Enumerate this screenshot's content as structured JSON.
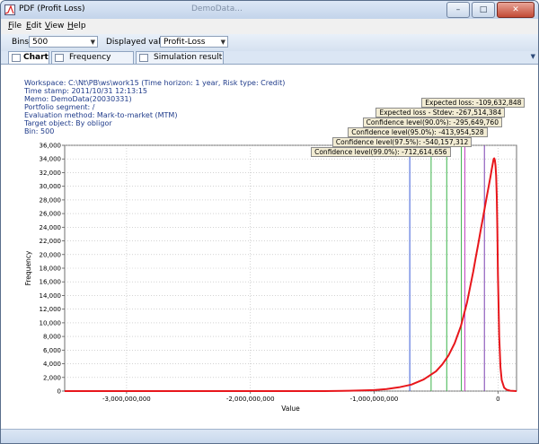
{
  "window": {
    "title": "PDF (Profit Loss)",
    "ghost_title": "DemoData..."
  },
  "titlebar_buttons": {
    "minimize": "–",
    "maximize": "□",
    "close": "✕"
  },
  "menu": {
    "items": [
      {
        "label": "File",
        "mnemonic": "F",
        "rest": "ile"
      },
      {
        "label": "Edit",
        "mnemonic": "E",
        "rest": "dit"
      },
      {
        "label": "View",
        "mnemonic": "V",
        "rest": "iew"
      },
      {
        "label": "Help",
        "mnemonic": "H",
        "rest": "elp"
      }
    ]
  },
  "toolbar": {
    "bins_label": "Bins:",
    "bins_value": "500",
    "displayed_label": "Displayed value:",
    "displayed_value": "Profit-Loss"
  },
  "tabs": [
    {
      "label": "Chart",
      "active": true
    },
    {
      "label": "Frequency table",
      "active": false
    },
    {
      "label": "Simulation result",
      "active": false
    }
  ],
  "meta": {
    "workspace": "Workspace: C:\\Nt\\PB\\ws\\work15 (Time horizon: 1 year, Risk type: Credit)",
    "timestamp": "Time stamp: 2011/10/31 12:13:15",
    "memo": "Memo: DemoData(20030331)",
    "portfolio": "Portfolio segment: /",
    "method": "Evaluation method: Mark-to-market (MTM)",
    "target": "Target object: By obligor",
    "bin": "Bin: 500"
  },
  "chart_data": {
    "type": "area",
    "xlabel": "Value",
    "ylabel": "Frequency",
    "xlim": [
      -3500000000,
      150000000
    ],
    "ylim": [
      0,
      36000
    ],
    "x_ticks": [
      -3000000000,
      -2000000000,
      -1000000000,
      0
    ],
    "x_tick_labels": [
      "-3,000,000,000",
      "-2,000,000,000",
      "-1,000,000,000",
      "0"
    ],
    "y_ticks": [
      0,
      2000,
      4000,
      6000,
      8000,
      10000,
      12000,
      14000,
      16000,
      18000,
      20000,
      22000,
      24000,
      26000,
      28000,
      30000,
      32000,
      34000,
      36000
    ],
    "y_tick_labels": [
      "0",
      "2,000",
      "4,000",
      "6,000",
      "8,000",
      "10,000",
      "12,000",
      "14,000",
      "16,000",
      "18,000",
      "20,000",
      "22,000",
      "24,000",
      "26,000",
      "28,000",
      "30,000",
      "32,000",
      "34,000",
      "36,000"
    ],
    "grid": true,
    "series_color": "#e8161b",
    "distribution": {
      "x": [
        -3500000000,
        -1400000000,
        -1200000000,
        -1000000000,
        -900000000,
        -800000000,
        -700000000,
        -600000000,
        -500000000,
        -450000000,
        -400000000,
        -350000000,
        -300000000,
        -250000000,
        -200000000,
        -180000000,
        -160000000,
        -140000000,
        -120000000,
        -100000000,
        -90000000,
        -80000000,
        -70000000,
        -60000000,
        -50000000,
        -45000000,
        -40000000,
        -35000000,
        -30000000,
        -25000000,
        -20000000,
        -15000000,
        -10000000,
        -5000000,
        0,
        10000000,
        20000000,
        30000000,
        50000000,
        70000000,
        100000000,
        150000000
      ],
      "y": [
        0,
        0,
        50,
        150,
        300,
        550,
        950,
        1700,
        2900,
        3900,
        5200,
        7000,
        9500,
        13000,
        17500,
        19500,
        21500,
        23500,
        25500,
        27500,
        28500,
        29500,
        30500,
        31500,
        32500,
        33000,
        33500,
        34000,
        34100,
        33800,
        33000,
        31500,
        28500,
        24000,
        17000,
        8000,
        3500,
        1600,
        500,
        200,
        50,
        0
      ]
    },
    "markers": [
      {
        "label": "Expected loss: -109,632,848",
        "value": -109632848,
        "color": "#7a3fb0"
      },
      {
        "label": "Expected loss - Stdev: -267,514,384",
        "value": -267514384,
        "color": "#c040c0"
      },
      {
        "label": "Confidence level(90.0%): -295,649,760",
        "value": -295649760,
        "color": "#3cb34a"
      },
      {
        "label": "Confidence level(95.0%): -413,954,528",
        "value": -413954528,
        "color": "#3cb34a"
      },
      {
        "label": "Confidence level(97.5%): -540,157,312",
        "value": -540157312,
        "color": "#3cb34a"
      },
      {
        "label": "Confidence level(99.0%): -712,614,656",
        "value": -712614656,
        "color": "#3a5bd8"
      }
    ]
  }
}
